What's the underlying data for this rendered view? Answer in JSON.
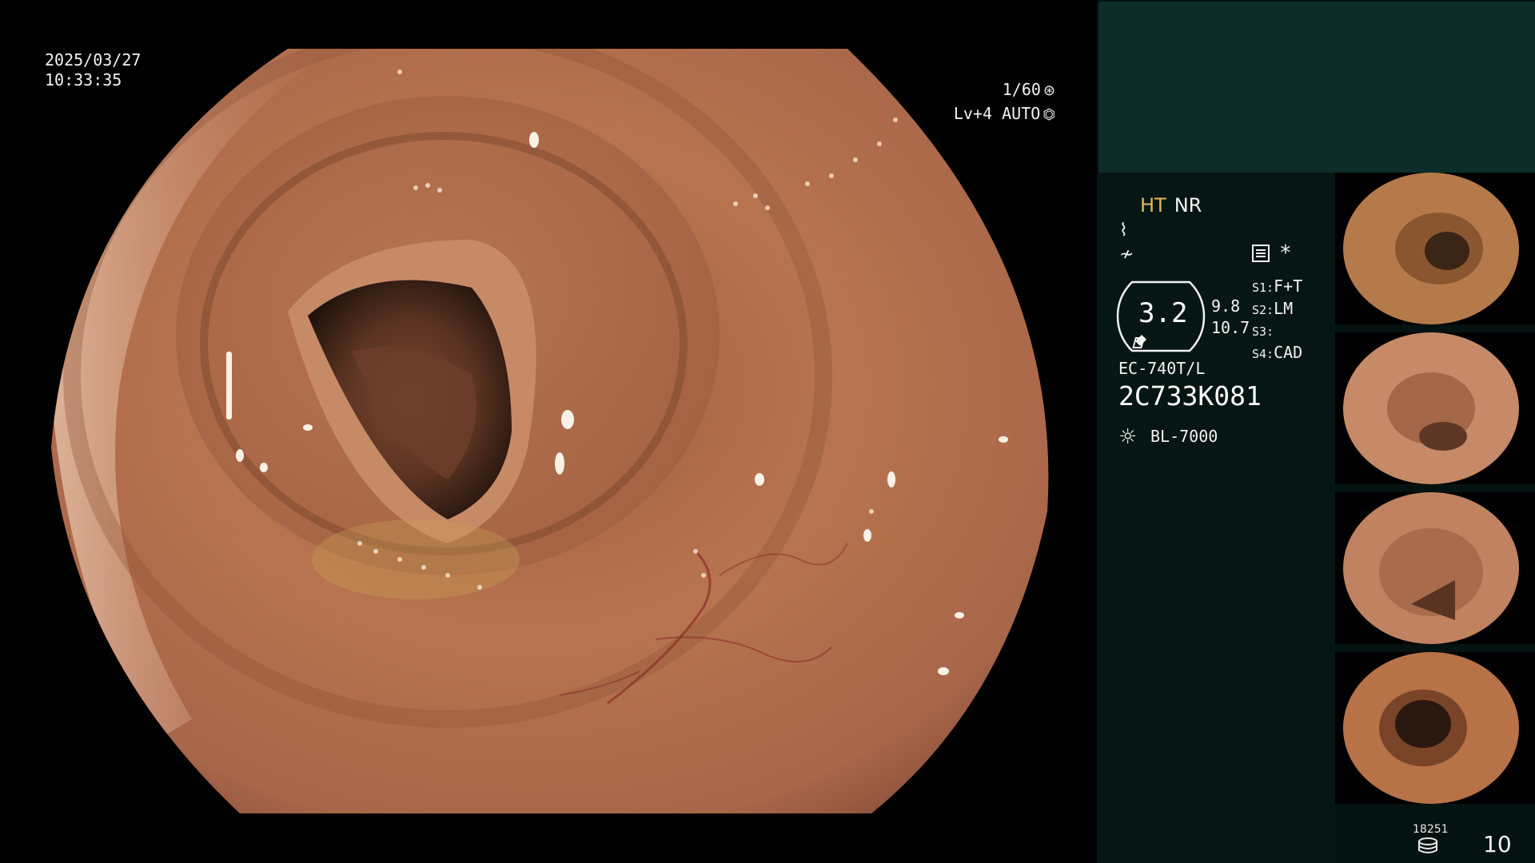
{
  "overlay": {
    "date": "2025/03/27",
    "time": "10:33:35",
    "shutter": "1/60",
    "shutter_icon": "aperture-icon",
    "level": "Lv+4",
    "exposure_mode": "AUTO",
    "exposure_icon": "auto-exposure-icon"
  },
  "panel": {
    "mode_ht": "HT",
    "mode_nr": "NR",
    "icon_1": "structure-enhancement-icon",
    "icon_2": "color-enhancement-icon",
    "menu_icon": "menu-list-icon",
    "star": "*",
    "zoom": "3.2",
    "enhancement_1": "9.8",
    "enhancement_2": "10.7",
    "slots": [
      {
        "key": "S1:",
        "value": "F+T"
      },
      {
        "key": "S2:",
        "value": "LM"
      },
      {
        "key": "S3:",
        "value": ""
      },
      {
        "key": "S4:",
        "value": "CAD"
      }
    ],
    "scope_model": "EC-740T/L",
    "scope_serial": "2C733K081",
    "light_source": "BL-7000"
  },
  "footer": {
    "image_count": "18251",
    "page_number": "10"
  },
  "colors": {
    "mucosa": "#b5714c",
    "mucosa_dark": "#6b3a24",
    "highlight_orange": "#e6b85a",
    "panel_bg": "#061614",
    "panel_top": "#0d2d2a"
  }
}
